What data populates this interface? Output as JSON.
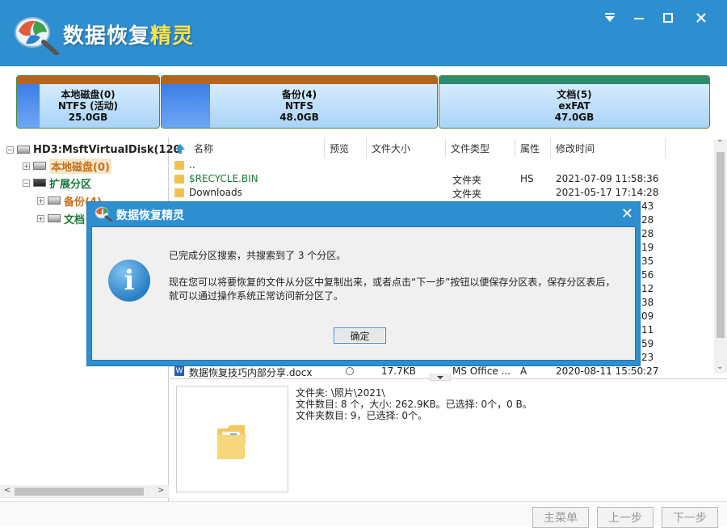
{
  "app": {
    "title_main": "数据恢复",
    "title_accent": "精灵"
  },
  "window_controls": {
    "menu": "▼",
    "minimize": "—",
    "maximize": "□",
    "close": "✕"
  },
  "partitions": [
    {
      "name": "本地磁盘(0)",
      "fs": "NTFS (活动)",
      "size": "25.0GB",
      "strip_color": "#b5651d"
    },
    {
      "name": "备份(4)",
      "fs": "NTFS",
      "size": "48.0GB",
      "strip_color": "#b5651d"
    },
    {
      "name": "文档(5)",
      "fs": "exFAT",
      "size": "47.0GB",
      "strip_color": "#2e8b6e"
    }
  ],
  "tree": {
    "root": "HD3:MsftVirtualDisk(120",
    "items": [
      {
        "label": "本地磁盘(0)",
        "color": "#c4701a"
      },
      {
        "label": "扩展分区",
        "color": "#1a7a3a"
      },
      {
        "label": "备份(4)",
        "color": "#c4701a"
      },
      {
        "label": "文档",
        "color": "#1a7a3a"
      }
    ]
  },
  "columns": [
    "名称",
    "预览",
    "文件大小",
    "文件类型",
    "属性",
    "修改时间"
  ],
  "files": [
    {
      "name": "..",
      "size": "",
      "type": "",
      "attr": "",
      "mtime": ""
    },
    {
      "name": "$RECYCLE.BIN",
      "size": "",
      "type": "文件夹",
      "attr": "HS",
      "mtime": "2021-07-09 11:58:36"
    },
    {
      "name": "Downloads",
      "size": "",
      "type": "文件夹",
      "attr": "",
      "mtime": "2021-05-17 17:14:28"
    },
    {
      "name": "数据恢复技巧内部分享.docx",
      "size": "17.7KB",
      "type": "MS Office ...",
      "attr": "A",
      "mtime": "2020-08-11 15:50:27"
    }
  ],
  "hidden_time_suffixes": [
    "43",
    "28",
    "28",
    "19",
    "35",
    "56",
    "12",
    "38",
    "09",
    "11",
    "59",
    "23"
  ],
  "detail": {
    "folder": "文件夹: \\照片\\2021\\",
    "file_count": "文件数目: 8 个，大小: 262.9KB。已选择: 0个，0 B。",
    "folder_count": "文件夹数目: 9，已选择: 0个。"
  },
  "footer": {
    "main_menu": "主菜单",
    "prev": "上一步",
    "next": "下一步"
  },
  "dialog": {
    "title": "数据恢复精灵",
    "close": "✕",
    "message1": "已完成分区搜索，共搜索到了 3 个分区。",
    "message2": "现在您可以将要恢复的文件从分区中复制出来，或者点击“下一步”按钮以便保存分区表，保存分区表后，就可以通过操作系统正常访问新分区了。",
    "ok": "确定",
    "icon": "i"
  },
  "colors": {
    "titlebar": "#2e8fd0",
    "link": "#1a7a3a"
  }
}
